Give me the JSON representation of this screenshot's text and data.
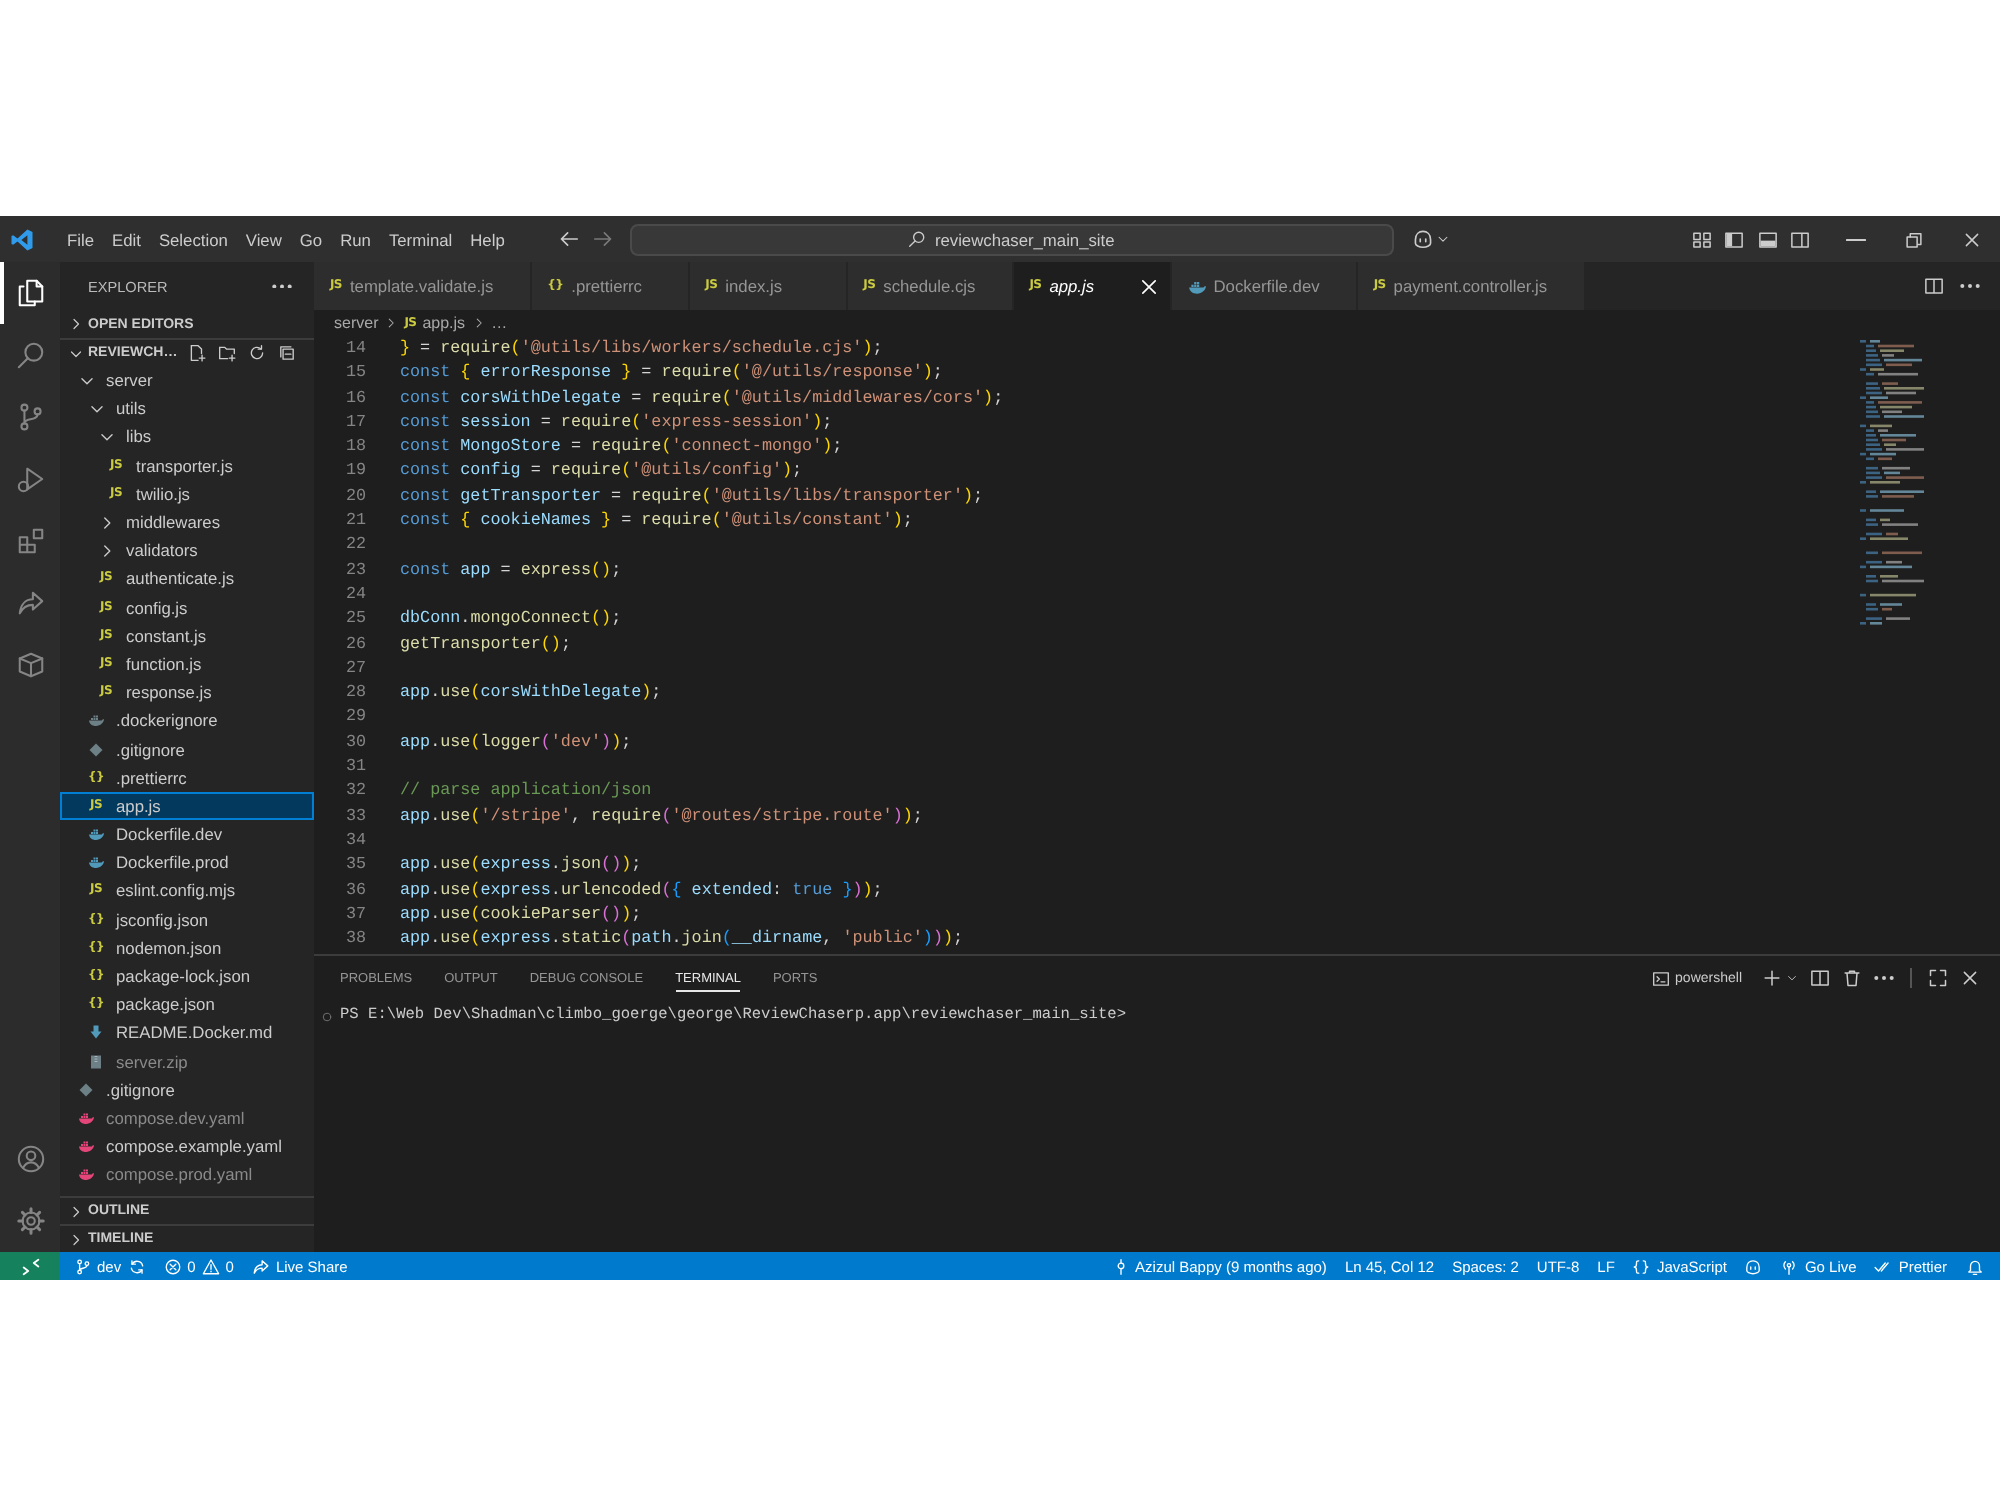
{
  "title_bar": {
    "menus": [
      "File",
      "Edit",
      "Selection",
      "View",
      "Go",
      "Run",
      "Terminal",
      "Help"
    ],
    "command_center": {
      "text": "reviewchaser_main_site"
    }
  },
  "activity_bar": {
    "items": [
      {
        "kind": "explorer",
        "selected": true
      },
      {
        "kind": "search",
        "selected": false
      },
      {
        "kind": "source_control",
        "selected": false
      },
      {
        "kind": "run_debug",
        "selected": false
      },
      {
        "kind": "extensions",
        "selected": false
      },
      {
        "kind": "live_share",
        "selected": false
      },
      {
        "kind": "containers",
        "selected": false
      }
    ],
    "bottom": [
      {
        "kind": "accounts"
      },
      {
        "kind": "settings"
      }
    ]
  },
  "sidebar": {
    "title": "EXPLORER",
    "sections": [
      {
        "title": "OPEN EDITORS",
        "expanded": false
      },
      {
        "title": "REVIEWCH…",
        "expanded": true,
        "tree": [
          {
            "name": "server",
            "kind": "folder",
            "expanded": true,
            "selected": false,
            "dimmed": false,
            "children": [
              {
                "name": "utils",
                "kind": "folder",
                "expanded": true,
                "selected": false,
                "dimmed": false,
                "children": [
                  {
                    "name": "libs",
                    "kind": "folder",
                    "expanded": true,
                    "selected": false,
                    "dimmed": false,
                    "children": [
                      {
                        "name": "transporter.js",
                        "kind": "js",
                        "glyph": "JS",
                        "selected": false,
                        "dimmed": false
                      },
                      {
                        "name": "twilio.js",
                        "kind": "js",
                        "glyph": "JS",
                        "selected": false,
                        "dimmed": false
                      }
                    ]
                  },
                  {
                    "name": "middlewares",
                    "kind": "folder",
                    "expanded": false,
                    "selected": false,
                    "dimmed": false
                  },
                  {
                    "name": "validators",
                    "kind": "folder",
                    "expanded": false,
                    "selected": false,
                    "dimmed": false
                  },
                  {
                    "name": "authenticate.js",
                    "kind": "js",
                    "glyph": "JS",
                    "selected": false,
                    "dimmed": false
                  },
                  {
                    "name": "config.js",
                    "kind": "js",
                    "glyph": "JS",
                    "selected": false,
                    "dimmed": false
                  },
                  {
                    "name": "constant.js",
                    "kind": "js",
                    "glyph": "JS",
                    "selected": false,
                    "dimmed": false
                  },
                  {
                    "name": "function.js",
                    "kind": "js",
                    "glyph": "JS",
                    "selected": false,
                    "dimmed": false
                  },
                  {
                    "name": "response.js",
                    "kind": "js",
                    "glyph": "JS",
                    "selected": false,
                    "dimmed": false
                  }
                ]
              },
              {
                "name": ".dockerignore",
                "kind": "dockerignore",
                "selected": false,
                "dimmed": false
              },
              {
                "name": ".gitignore",
                "kind": "git",
                "selected": false,
                "dimmed": false
              },
              {
                "name": ".prettierrc",
                "kind": "json",
                "glyph": "{}",
                "selected": false,
                "dimmed": false
              },
              {
                "name": "app.js",
                "kind": "js",
                "glyph": "JS",
                "selected": true,
                "dimmed": false
              },
              {
                "name": "Dockerfile.dev",
                "kind": "docker",
                "selected": false,
                "dimmed": false
              },
              {
                "name": "Dockerfile.prod",
                "kind": "docker",
                "selected": false,
                "dimmed": false
              },
              {
                "name": "eslint.config.mjs",
                "kind": "js",
                "glyph": "JS",
                "selected": false,
                "dimmed": false
              },
              {
                "name": "jsconfig.json",
                "kind": "json",
                "glyph": "{}",
                "selected": false,
                "dimmed": false
              },
              {
                "name": "nodemon.json",
                "kind": "json",
                "glyph": "{}",
                "selected": false,
                "dimmed": false
              },
              {
                "name": "package-lock.json",
                "kind": "json",
                "glyph": "{}",
                "selected": false,
                "dimmed": false
              },
              {
                "name": "package.json",
                "kind": "json",
                "glyph": "{}",
                "selected": false,
                "dimmed": false
              },
              {
                "name": "README.Docker.md",
                "kind": "md",
                "selected": false,
                "dimmed": false
              },
              {
                "name": "server.zip",
                "kind": "zip",
                "selected": false,
                "dimmed": true
              }
            ]
          },
          {
            "name": ".gitignore",
            "kind": "git",
            "selected": false,
            "dimmed": false
          },
          {
            "name": "compose.dev.yaml",
            "kind": "compose",
            "selected": false,
            "dimmed": true
          },
          {
            "name": "compose.example.yaml",
            "kind": "compose",
            "selected": false,
            "dimmed": false
          },
          {
            "name": "compose.prod.yaml",
            "kind": "compose",
            "selected": false,
            "dimmed": true
          }
        ]
      },
      {
        "title": "OUTLINE",
        "expanded": false
      },
      {
        "title": "TIMELINE",
        "expanded": false
      }
    ]
  },
  "editor": {
    "tabs": [
      {
        "label": "template.validate.js",
        "kind": "js",
        "glyph": "JS",
        "selected": false,
        "preview": false
      },
      {
        "label": ".prettierrc",
        "kind": "json",
        "glyph": "{}",
        "selected": false,
        "preview": false
      },
      {
        "label": "index.js",
        "kind": "js",
        "glyph": "JS",
        "selected": false,
        "preview": false
      },
      {
        "label": "schedule.cjs",
        "kind": "js",
        "glyph": "JS",
        "selected": false,
        "preview": false
      },
      {
        "label": "app.js",
        "kind": "js",
        "glyph": "JS",
        "selected": true,
        "preview": true
      },
      {
        "label": "Dockerfile.dev",
        "kind": "docker",
        "selected": false,
        "preview": false
      },
      {
        "label": "payment.controller.js",
        "kind": "js",
        "glyph": "JS",
        "selected": false,
        "preview": false
      }
    ],
    "breadcrumbs": [
      {
        "label": "server"
      },
      {
        "label": "app.js",
        "kind": "js",
        "glyph": "JS"
      },
      {
        "label": "…"
      }
    ],
    "lines": [
      {
        "number": "14",
        "tokens": [
          {
            "kind": "b1",
            "text": "}"
          },
          {
            "kind": "p",
            "text": " = "
          },
          {
            "kind": "fn",
            "text": "require"
          },
          {
            "kind": "b1",
            "text": "("
          },
          {
            "kind": "str",
            "text": "'@utils/libs/workers/schedule.cjs'"
          },
          {
            "kind": "b1",
            "text": ")"
          },
          {
            "kind": "p",
            "text": ";"
          }
        ]
      },
      {
        "number": "15",
        "tokens": [
          {
            "kind": "kw",
            "text": "const "
          },
          {
            "kind": "b1",
            "text": "{"
          },
          {
            "kind": "var",
            "text": " errorResponse "
          },
          {
            "kind": "b1",
            "text": "}"
          },
          {
            "kind": "p",
            "text": " = "
          },
          {
            "kind": "fn",
            "text": "require"
          },
          {
            "kind": "b1",
            "text": "("
          },
          {
            "kind": "str",
            "text": "'@/utils/response'"
          },
          {
            "kind": "b1",
            "text": ")"
          },
          {
            "kind": "p",
            "text": ";"
          }
        ]
      },
      {
        "number": "16",
        "tokens": [
          {
            "kind": "kw",
            "text": "const "
          },
          {
            "kind": "var",
            "text": "corsWithDelegate"
          },
          {
            "kind": "p",
            "text": " = "
          },
          {
            "kind": "fn",
            "text": "require"
          },
          {
            "kind": "b1",
            "text": "("
          },
          {
            "kind": "str",
            "text": "'@utils/middlewares/cors'"
          },
          {
            "kind": "b1",
            "text": ")"
          },
          {
            "kind": "p",
            "text": ";"
          }
        ]
      },
      {
        "number": "17",
        "tokens": [
          {
            "kind": "kw",
            "text": "const "
          },
          {
            "kind": "var",
            "text": "session"
          },
          {
            "kind": "p",
            "text": " = "
          },
          {
            "kind": "fn",
            "text": "require"
          },
          {
            "kind": "b1",
            "text": "("
          },
          {
            "kind": "str",
            "text": "'express-session'"
          },
          {
            "kind": "b1",
            "text": ")"
          },
          {
            "kind": "p",
            "text": ";"
          }
        ]
      },
      {
        "number": "18",
        "tokens": [
          {
            "kind": "kw",
            "text": "const "
          },
          {
            "kind": "var",
            "text": "MongoStore"
          },
          {
            "kind": "p",
            "text": " = "
          },
          {
            "kind": "fn",
            "text": "require"
          },
          {
            "kind": "b1",
            "text": "("
          },
          {
            "kind": "str",
            "text": "'connect-mongo'"
          },
          {
            "kind": "b1",
            "text": ")"
          },
          {
            "kind": "p",
            "text": ";"
          }
        ]
      },
      {
        "number": "19",
        "tokens": [
          {
            "kind": "kw",
            "text": "const "
          },
          {
            "kind": "var",
            "text": "config"
          },
          {
            "kind": "p",
            "text": " = "
          },
          {
            "kind": "fn",
            "text": "require"
          },
          {
            "kind": "b1",
            "text": "("
          },
          {
            "kind": "str",
            "text": "'@utils/config'"
          },
          {
            "kind": "b1",
            "text": ")"
          },
          {
            "kind": "p",
            "text": ";"
          }
        ]
      },
      {
        "number": "20",
        "tokens": [
          {
            "kind": "kw",
            "text": "const "
          },
          {
            "kind": "var",
            "text": "getTransporter"
          },
          {
            "kind": "p",
            "text": " = "
          },
          {
            "kind": "fn",
            "text": "require"
          },
          {
            "kind": "b1",
            "text": "("
          },
          {
            "kind": "str",
            "text": "'@utils/libs/transporter'"
          },
          {
            "kind": "b1",
            "text": ")"
          },
          {
            "kind": "p",
            "text": ";"
          }
        ]
      },
      {
        "number": "21",
        "tokens": [
          {
            "kind": "kw",
            "text": "const "
          },
          {
            "kind": "b1",
            "text": "{"
          },
          {
            "kind": "var",
            "text": " cookieNames "
          },
          {
            "kind": "b1",
            "text": "}"
          },
          {
            "kind": "p",
            "text": " = "
          },
          {
            "kind": "fn",
            "text": "require"
          },
          {
            "kind": "b1",
            "text": "("
          },
          {
            "kind": "str",
            "text": "'@utils/constant'"
          },
          {
            "kind": "b1",
            "text": ")"
          },
          {
            "kind": "p",
            "text": ";"
          }
        ]
      },
      {
        "number": "22"
      },
      {
        "number": "23",
        "tokens": [
          {
            "kind": "kw",
            "text": "const "
          },
          {
            "kind": "var",
            "text": "app"
          },
          {
            "kind": "p",
            "text": " = "
          },
          {
            "kind": "fn",
            "text": "express"
          },
          {
            "kind": "b1",
            "text": "()"
          },
          {
            "kind": "p",
            "text": ";"
          }
        ]
      },
      {
        "number": "24"
      },
      {
        "number": "25",
        "tokens": [
          {
            "kind": "var",
            "text": "dbConn"
          },
          {
            "kind": "p",
            "text": "."
          },
          {
            "kind": "fn",
            "text": "mongoConnect"
          },
          {
            "kind": "b1",
            "text": "()"
          },
          {
            "kind": "p",
            "text": ";"
          }
        ]
      },
      {
        "number": "26",
        "tokens": [
          {
            "kind": "fn",
            "text": "getTransporter"
          },
          {
            "kind": "b1",
            "text": "()"
          },
          {
            "kind": "p",
            "text": ";"
          }
        ]
      },
      {
        "number": "27"
      },
      {
        "number": "28",
        "tokens": [
          {
            "kind": "var",
            "text": "app"
          },
          {
            "kind": "p",
            "text": "."
          },
          {
            "kind": "fn",
            "text": "use"
          },
          {
            "kind": "b1",
            "text": "("
          },
          {
            "kind": "var",
            "text": "corsWithDelegate"
          },
          {
            "kind": "b1",
            "text": ")"
          },
          {
            "kind": "p",
            "text": ";"
          }
        ]
      },
      {
        "number": "29"
      },
      {
        "number": "30",
        "tokens": [
          {
            "kind": "var",
            "text": "app"
          },
          {
            "kind": "p",
            "text": "."
          },
          {
            "kind": "fn",
            "text": "use"
          },
          {
            "kind": "b1",
            "text": "("
          },
          {
            "kind": "fn",
            "text": "logger"
          },
          {
            "kind": "b2",
            "text": "("
          },
          {
            "kind": "str",
            "text": "'dev'"
          },
          {
            "kind": "b2",
            "text": ")"
          },
          {
            "kind": "b1",
            "text": ")"
          },
          {
            "kind": "p",
            "text": ";"
          }
        ]
      },
      {
        "number": "31"
      },
      {
        "number": "32",
        "tokens": [
          {
            "kind": "cm",
            "text": "// parse application/json"
          }
        ]
      },
      {
        "number": "33",
        "tokens": [
          {
            "kind": "var",
            "text": "app"
          },
          {
            "kind": "p",
            "text": "."
          },
          {
            "kind": "fn",
            "text": "use"
          },
          {
            "kind": "b1",
            "text": "("
          },
          {
            "kind": "str",
            "text": "'/stripe'"
          },
          {
            "kind": "p",
            "text": ", "
          },
          {
            "kind": "fn",
            "text": "require"
          },
          {
            "kind": "b2",
            "text": "("
          },
          {
            "kind": "str",
            "text": "'@routes/stripe.route'"
          },
          {
            "kind": "b2",
            "text": ")"
          },
          {
            "kind": "b1",
            "text": ")"
          },
          {
            "kind": "p",
            "text": ";"
          }
        ]
      },
      {
        "number": "34"
      },
      {
        "number": "35",
        "tokens": [
          {
            "kind": "var",
            "text": "app"
          },
          {
            "kind": "p",
            "text": "."
          },
          {
            "kind": "fn",
            "text": "use"
          },
          {
            "kind": "b1",
            "text": "("
          },
          {
            "kind": "var",
            "text": "express"
          },
          {
            "kind": "p",
            "text": "."
          },
          {
            "kind": "fn",
            "text": "json"
          },
          {
            "kind": "b2",
            "text": "()"
          },
          {
            "kind": "b1",
            "text": ")"
          },
          {
            "kind": "p",
            "text": ";"
          }
        ]
      },
      {
        "number": "36",
        "tokens": [
          {
            "kind": "var",
            "text": "app"
          },
          {
            "kind": "p",
            "text": "."
          },
          {
            "kind": "fn",
            "text": "use"
          },
          {
            "kind": "b1",
            "text": "("
          },
          {
            "kind": "var",
            "text": "express"
          },
          {
            "kind": "p",
            "text": "."
          },
          {
            "kind": "fn",
            "text": "urlencoded"
          },
          {
            "kind": "b2",
            "text": "("
          },
          {
            "kind": "b3",
            "text": "{"
          },
          {
            "kind": "var",
            "text": " extended"
          },
          {
            "kind": "p",
            "text": ": "
          },
          {
            "kind": "kw",
            "text": "true"
          },
          {
            "kind": "b3",
            "text": " }"
          },
          {
            "kind": "b2",
            "text": ")"
          },
          {
            "kind": "b1",
            "text": ")"
          },
          {
            "kind": "p",
            "text": ";"
          }
        ]
      },
      {
        "number": "37",
        "tokens": [
          {
            "kind": "var",
            "text": "app"
          },
          {
            "kind": "p",
            "text": "."
          },
          {
            "kind": "fn",
            "text": "use"
          },
          {
            "kind": "b1",
            "text": "("
          },
          {
            "kind": "fn",
            "text": "cookieParser"
          },
          {
            "kind": "b2",
            "text": "()"
          },
          {
            "kind": "b1",
            "text": ")"
          },
          {
            "kind": "p",
            "text": ";"
          }
        ]
      },
      {
        "number": "38",
        "tokens": [
          {
            "kind": "var",
            "text": "app"
          },
          {
            "kind": "p",
            "text": "."
          },
          {
            "kind": "fn",
            "text": "use"
          },
          {
            "kind": "b1",
            "text": "("
          },
          {
            "kind": "var",
            "text": "express"
          },
          {
            "kind": "p",
            "text": "."
          },
          {
            "kind": "fn",
            "text": "static"
          },
          {
            "kind": "b2",
            "text": "("
          },
          {
            "kind": "var",
            "text": "path"
          },
          {
            "kind": "p",
            "text": "."
          },
          {
            "kind": "fn",
            "text": "join"
          },
          {
            "kind": "b3",
            "text": "("
          },
          {
            "kind": "var",
            "text": "__dirname"
          },
          {
            "kind": "p",
            "text": ", "
          },
          {
            "kind": "str",
            "text": "'public'"
          },
          {
            "kind": "b3",
            "text": ")"
          },
          {
            "kind": "b2",
            "text": ")"
          },
          {
            "kind": "b1",
            "text": ")"
          },
          {
            "kind": "p",
            "text": ";"
          }
        ]
      }
    ]
  },
  "panel": {
    "tabs": [
      {
        "label": "PROBLEMS",
        "selected": false
      },
      {
        "label": "OUTPUT",
        "selected": false
      },
      {
        "label": "DEBUG CONSOLE",
        "selected": false
      },
      {
        "label": "TERMINAL",
        "selected": true
      },
      {
        "label": "PORTS",
        "selected": false
      }
    ],
    "terminal": {
      "shell": "powershell",
      "lines": [
        "PS E:\\Web Dev\\Shadman\\climbo_goerge\\george\\ReviewChaserp.app\\reviewchaser_main_site>"
      ]
    }
  },
  "status_bar": {
    "left": [
      {
        "kind": "remote"
      },
      {
        "kind": "branch",
        "text": "dev"
      },
      {
        "kind": "problems",
        "errors": "0",
        "warnings": "0"
      },
      {
        "kind": "live_share",
        "text": "Live Share"
      }
    ],
    "right": [
      {
        "kind": "blame",
        "text": "Azizul Bappy (9 months ago)"
      },
      {
        "kind": "text",
        "text": "Ln 45, Col 12"
      },
      {
        "kind": "text",
        "text": "Spaces: 2"
      },
      {
        "kind": "text",
        "text": "UTF-8"
      },
      {
        "kind": "text",
        "text": "LF"
      },
      {
        "kind": "language",
        "text": "JavaScript"
      },
      {
        "kind": "copilot"
      },
      {
        "kind": "go_live",
        "text": "Go Live"
      },
      {
        "kind": "prettier",
        "text": "Prettier"
      },
      {
        "kind": "notifications"
      }
    ]
  }
}
